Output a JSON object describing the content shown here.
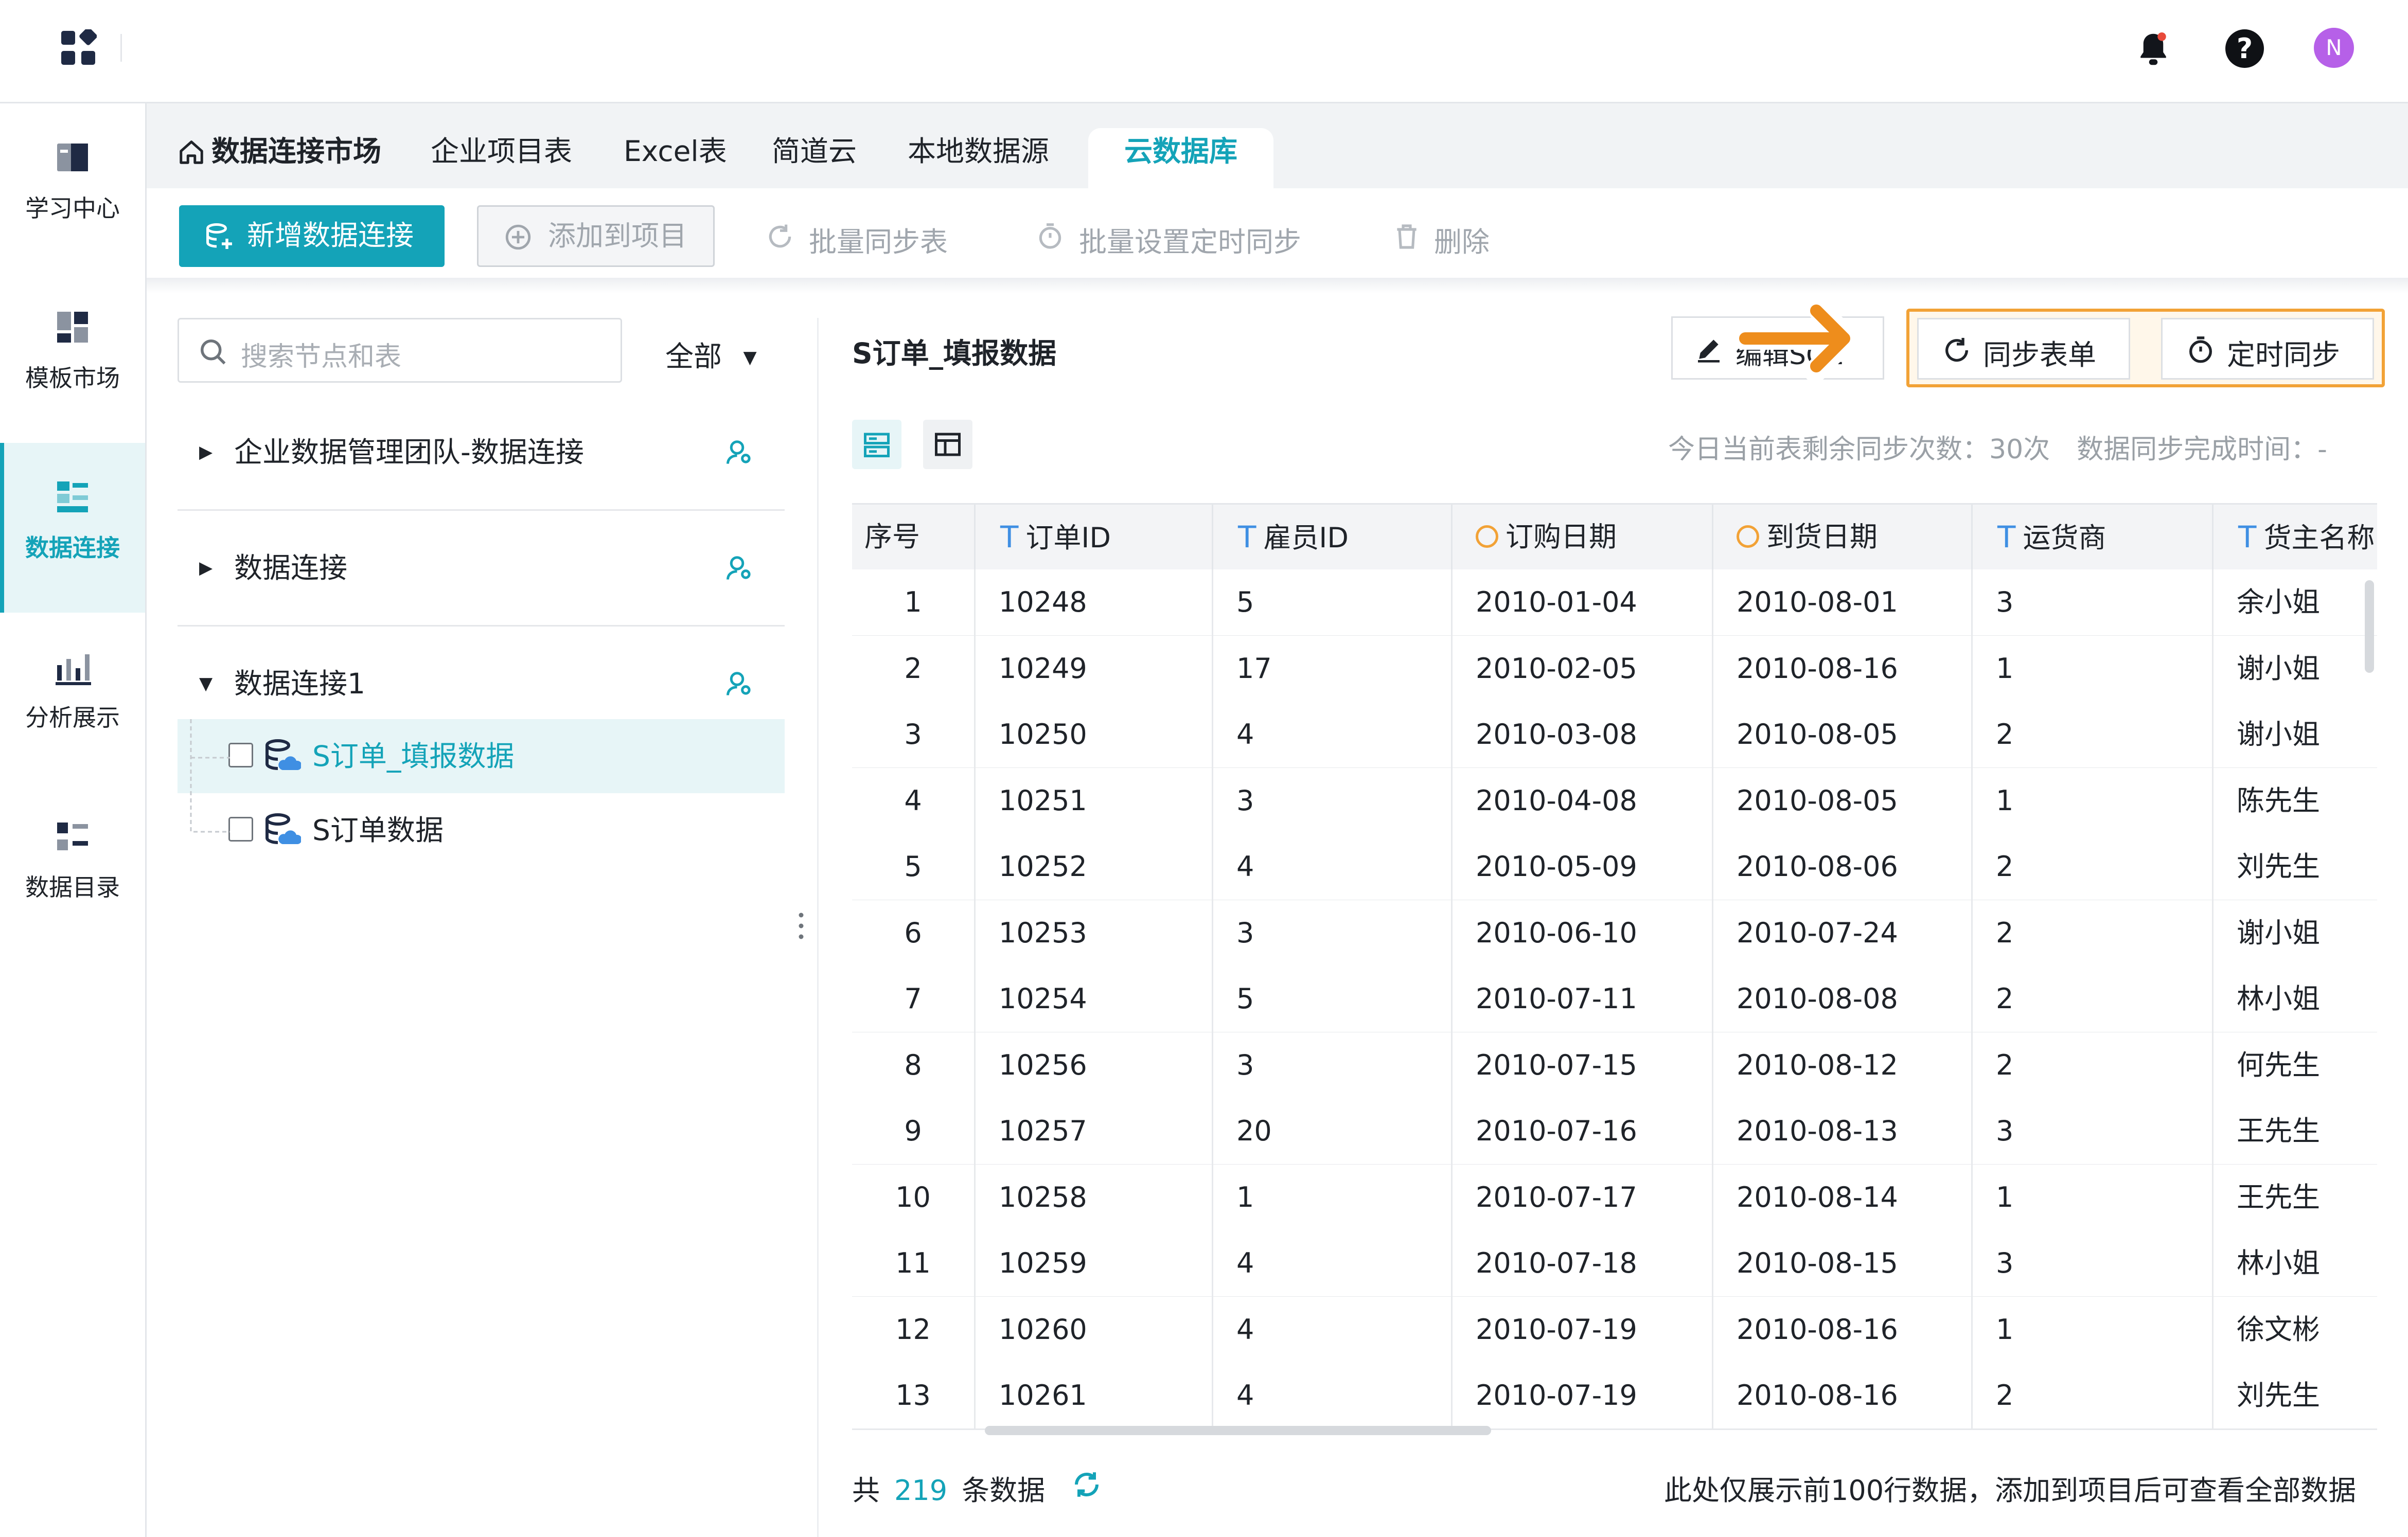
{
  "icons": {
    "app": "app-grid-icon",
    "bell": "bell-icon",
    "help": "help-icon"
  },
  "user": {
    "avatar_initial": "N"
  },
  "colors": {
    "accent": "#14a3b8",
    "highlight": "#f2a236",
    "avatar": "#b660e8"
  },
  "nav": [
    {
      "label": "学习中心",
      "icon": "book-icon"
    },
    {
      "label": "模板市场",
      "icon": "template-icon"
    },
    {
      "label": "数据连接",
      "icon": "data-connection-icon",
      "active": true
    },
    {
      "label": "分析展示",
      "icon": "chart-icon"
    },
    {
      "label": "数据目录",
      "icon": "catalog-icon"
    }
  ],
  "tabs": [
    "数据连接市场",
    "企业项目表",
    "Excel表",
    "简道云",
    "本地数据源",
    "云数据库"
  ],
  "active_tab": "云数据库",
  "toolbar": {
    "new_connection": "新增数据连接",
    "add_to_project": "添加到项目",
    "batch_sync": "批量同步表",
    "batch_schedule": "批量设置定时同步",
    "delete": "删除"
  },
  "tree": {
    "search_placeholder": "搜索节点和表",
    "filter": "全部",
    "groups": [
      {
        "name": "企业数据管理团队-数据连接",
        "expanded": false
      },
      {
        "name": "数据连接",
        "expanded": false
      },
      {
        "name": "数据连接1",
        "expanded": true
      }
    ],
    "leaves": [
      {
        "name": "S订单_填报数据",
        "selected": true
      },
      {
        "name": "S订单数据",
        "selected": false
      }
    ]
  },
  "detail": {
    "title": "S订单_填报数据",
    "edit_button": "编辑SQL",
    "sync_form_button": "同步表单",
    "scheduled_sync_button": "定时同步",
    "sync_info": "今日当前表剩余同步次数：30次　数据同步完成时间：-"
  },
  "table": {
    "columns": [
      {
        "label": "序号",
        "type": "index"
      },
      {
        "label": "订单ID",
        "type": "text"
      },
      {
        "label": "雇员ID",
        "type": "text"
      },
      {
        "label": "订购日期",
        "type": "date"
      },
      {
        "label": "到货日期",
        "type": "date"
      },
      {
        "label": "运货商",
        "type": "text"
      },
      {
        "label": "货主名称",
        "type": "text"
      }
    ],
    "rows": [
      [
        "1",
        "10248",
        "5",
        "2010-01-04",
        "2010-08-01",
        "3",
        "余小姐"
      ],
      [
        "2",
        "10249",
        "17",
        "2010-02-05",
        "2010-08-16",
        "1",
        "谢小姐"
      ],
      [
        "3",
        "10250",
        "4",
        "2010-03-08",
        "2010-08-05",
        "2",
        "谢小姐"
      ],
      [
        "4",
        "10251",
        "3",
        "2010-04-08",
        "2010-08-05",
        "1",
        "陈先生"
      ],
      [
        "5",
        "10252",
        "4",
        "2010-05-09",
        "2010-08-06",
        "2",
        "刘先生"
      ],
      [
        "6",
        "10253",
        "3",
        "2010-06-10",
        "2010-07-24",
        "2",
        "谢小姐"
      ],
      [
        "7",
        "10254",
        "5",
        "2010-07-11",
        "2010-08-08",
        "2",
        "林小姐"
      ],
      [
        "8",
        "10256",
        "3",
        "2010-07-15",
        "2010-08-12",
        "2",
        "何先生"
      ],
      [
        "9",
        "10257",
        "20",
        "2010-07-16",
        "2010-08-13",
        "3",
        "王先生"
      ],
      [
        "10",
        "10258",
        "1",
        "2010-07-17",
        "2010-08-14",
        "1",
        "王先生"
      ],
      [
        "11",
        "10259",
        "4",
        "2010-07-18",
        "2010-08-15",
        "3",
        "林小姐"
      ],
      [
        "12",
        "10260",
        "4",
        "2010-07-19",
        "2010-08-16",
        "1",
        "徐文彬"
      ],
      [
        "13",
        "10261",
        "4",
        "2010-07-19",
        "2010-08-16",
        "2",
        "刘先生"
      ]
    ]
  },
  "footer": {
    "count_prefix": "共",
    "count": "219",
    "count_suffix": "条数据",
    "note": "此处仅展示前100行数据，添加到项目后可查看全部数据"
  }
}
